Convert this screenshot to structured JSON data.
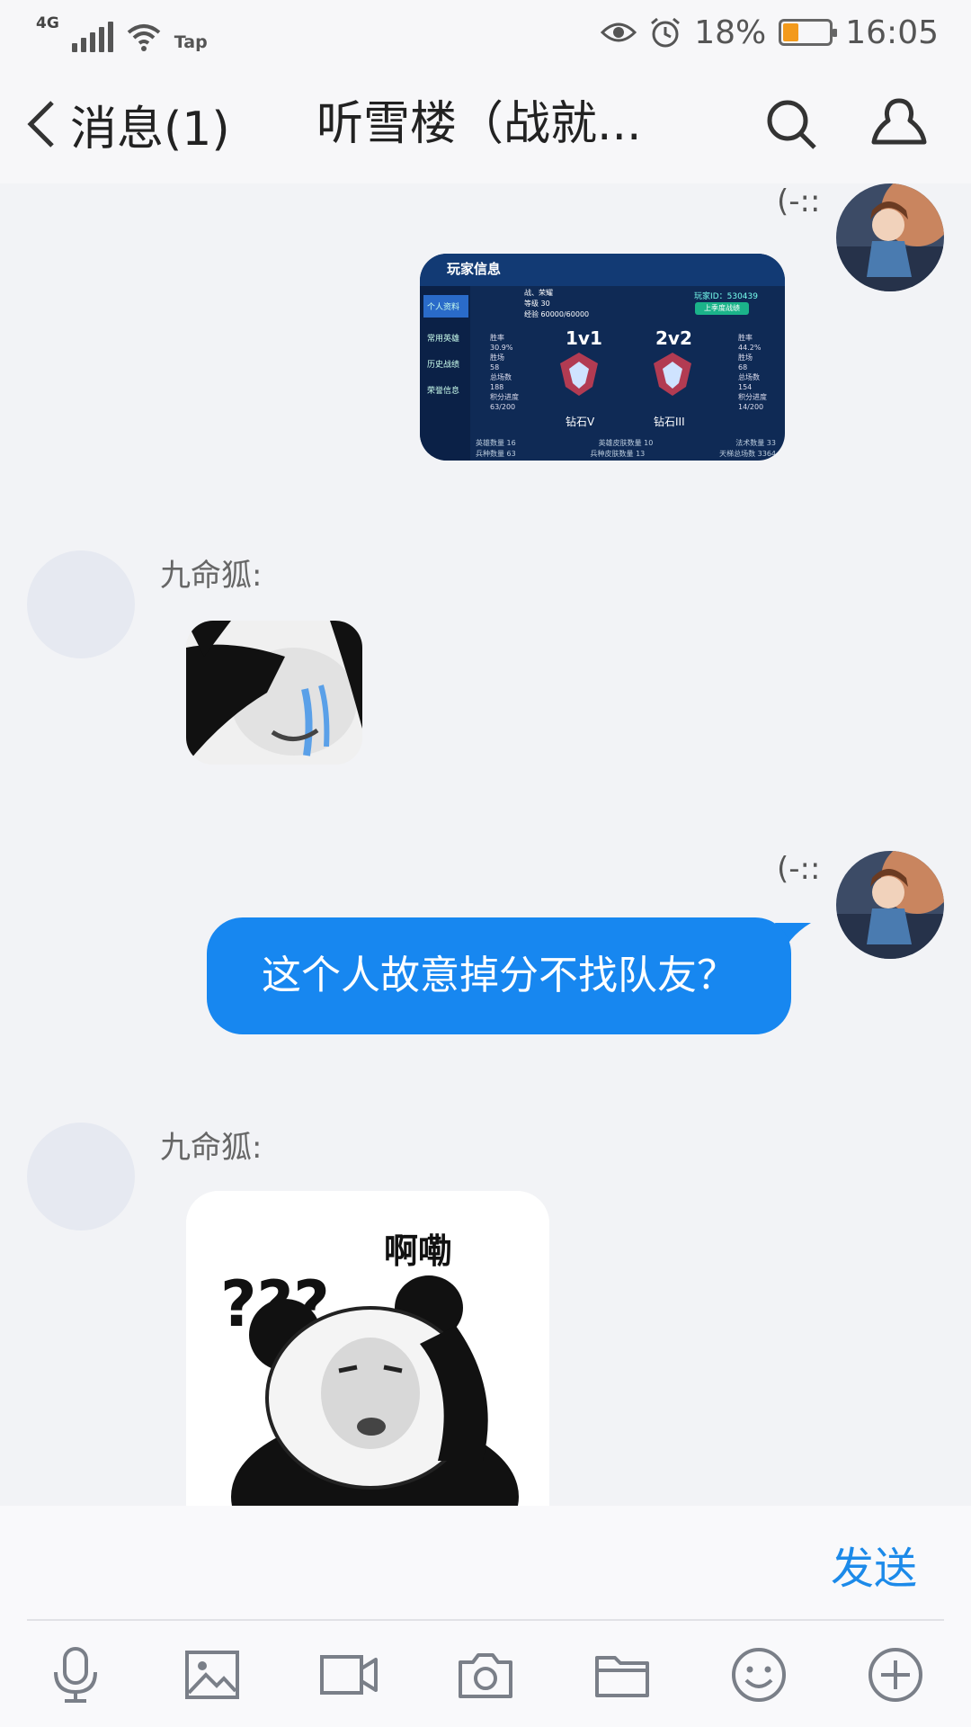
{
  "status_bar": {
    "network": "4G",
    "wifi_label": "Tap",
    "battery": "18%",
    "battery_level": 0.18,
    "time": "16:05",
    "icons": [
      "signal-icon",
      "wifi-icon",
      "eye-icon",
      "alarm-icon",
      "battery-icon"
    ]
  },
  "header": {
    "back_label": "消息(1)",
    "title": "听雪楼（战就...",
    "icons": [
      "back-icon",
      "search-icon",
      "group-profile-icon"
    ]
  },
  "messages": [
    {
      "side": "right",
      "tag": "(-::",
      "type": "image",
      "image": {
        "title": "玩家信息",
        "side_tabs": [
          "个人资料",
          "常用英雄",
          "历史战绩",
          "荣誉信息"
        ],
        "info_lines": [
          "战、荣耀",
          "等级 30",
          "经验 60000/60000"
        ],
        "player_id": "玩家ID：530439",
        "button": "上季度战绩",
        "modes": [
          {
            "name": "1v1",
            "rank": "钻石V",
            "stats": [
              "胜率",
              "30.9%",
              "胜场",
              "58",
              "总场数",
              "188",
              "积分进度",
              "63/200"
            ]
          },
          {
            "name": "2v2",
            "rank": "钻石III",
            "stats": [
              "胜率",
              "44.2%",
              "胜场",
              "68",
              "总场数",
              "154",
              "积分进度",
              "14/200"
            ]
          }
        ],
        "footer": [
          "英雄数量 16",
          "英雄皮肤数量 10",
          "法术数量 33",
          "兵种数量 63",
          "兵种皮肤数量 13",
          "天梯总场数 3364"
        ]
      }
    },
    {
      "side": "left",
      "sender": "九命狐:",
      "type": "sticker",
      "sticker": "crying-panda"
    },
    {
      "side": "right",
      "tag": "(-::",
      "type": "text",
      "text": "这个人故意掉分不找队友？"
    },
    {
      "side": "left",
      "sender": "九命狐:",
      "type": "sticker",
      "sticker": "confused-panda",
      "sticker_text": "啊嘞",
      "sticker_marks": "???"
    }
  ],
  "input": {
    "send_label": "发送"
  },
  "toolbar": [
    "microphone-icon",
    "image-icon",
    "video-icon",
    "camera-icon",
    "folder-icon",
    "emoji-icon",
    "plus-icon"
  ],
  "colors": {
    "accent": "#1787f0",
    "background": "#f2f3f6",
    "bar": "#f9f9fb"
  }
}
